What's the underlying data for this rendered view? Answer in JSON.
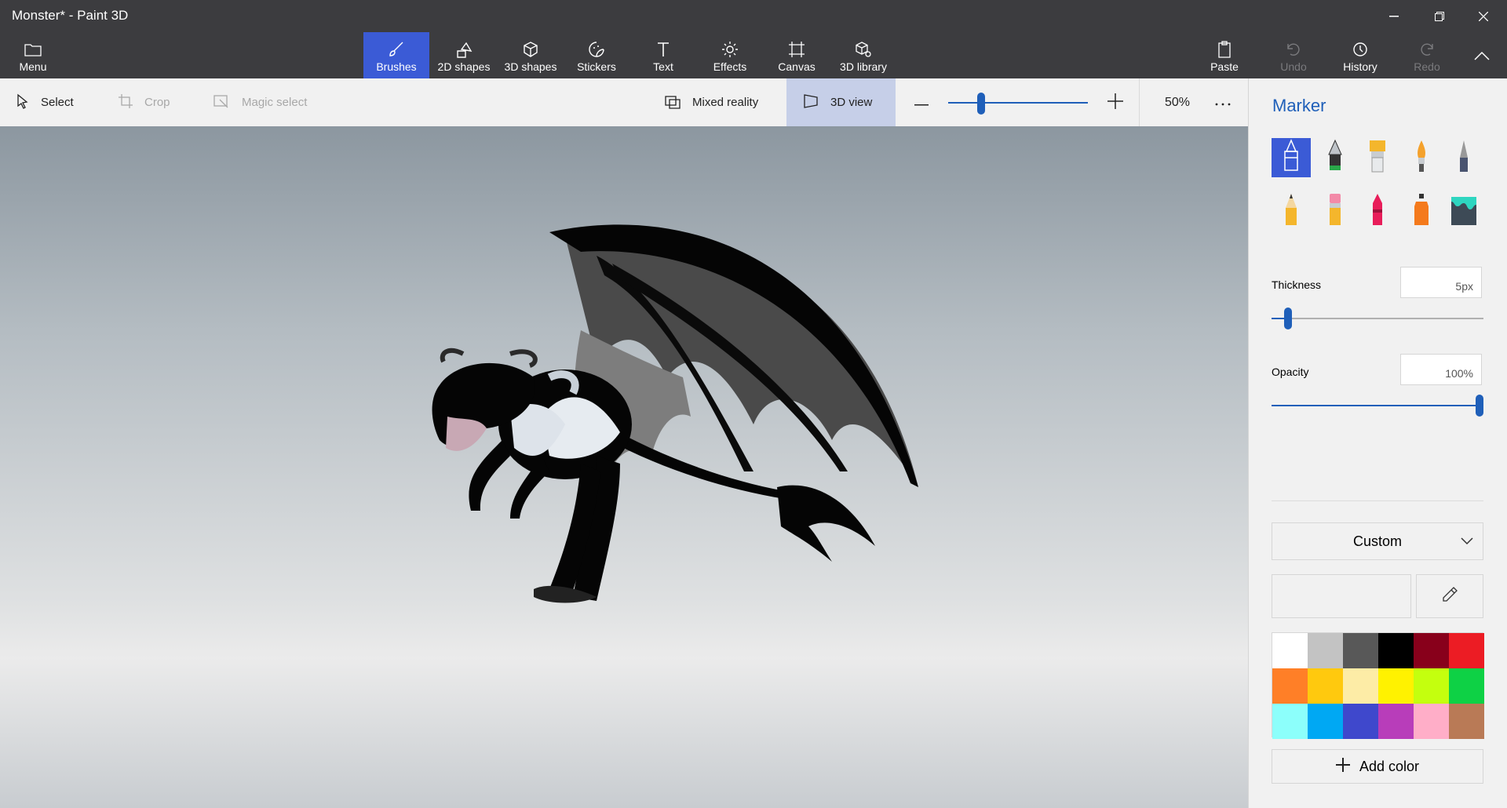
{
  "window": {
    "title": "Monster* - Paint 3D"
  },
  "ribbon": {
    "menu": "Menu",
    "tabs": [
      "Brushes",
      "2D shapes",
      "3D shapes",
      "Stickers",
      "Text",
      "Effects",
      "Canvas",
      "3D library"
    ],
    "active_tab": "Brushes",
    "paste": "Paste",
    "undo": "Undo",
    "history": "History",
    "redo": "Redo"
  },
  "toolbar": {
    "select": "Select",
    "crop": "Crop",
    "magic_select": "Magic select",
    "mixed_reality": "Mixed reality",
    "view_3d": "3D view",
    "zoom_percent": "50%",
    "zoom_level": 0.22
  },
  "panel": {
    "title": "Marker",
    "brushes": [
      "marker",
      "calligraphy-pen",
      "oil-brush",
      "watercolor",
      "pixel-pen",
      "pencil",
      "eraser",
      "crayon",
      "spray-can",
      "fill"
    ],
    "active_brush": "marker",
    "thickness_label": "Thickness",
    "thickness_value": "5px",
    "thickness_level": 0.06,
    "opacity_label": "Opacity",
    "opacity_value": "100%",
    "opacity_level": 1.0,
    "color_mode": "Custom",
    "add_color": "Add color",
    "palette": [
      "#ffffff",
      "#c3c3c3",
      "#585858",
      "#000000",
      "#88001b",
      "#ec1c24",
      "#ff7f27",
      "#ffc90e",
      "#fdeca6",
      "#fff200",
      "#c4ff0e",
      "#0ed145",
      "#8cfffb",
      "#00a8f3",
      "#3f48cc",
      "#b83dba",
      "#ffaec8",
      "#b97a56"
    ],
    "accent": "#1f5fb9"
  }
}
